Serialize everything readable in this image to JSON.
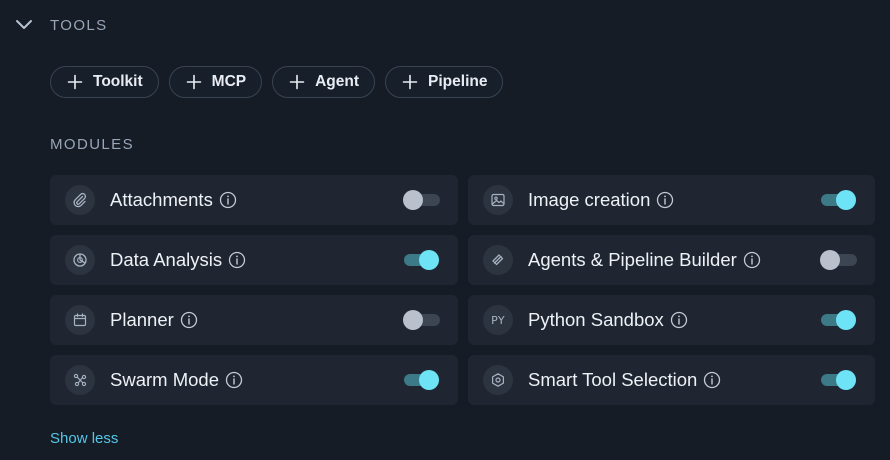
{
  "tools": {
    "title": "TOOLS",
    "add_buttons": [
      {
        "label": "Toolkit"
      },
      {
        "label": "MCP"
      },
      {
        "label": "Agent"
      },
      {
        "label": "Pipeline"
      }
    ]
  },
  "modules": {
    "title": "MODULES",
    "items": [
      {
        "label": "Attachments",
        "icon": "paperclip-icon",
        "enabled": false
      },
      {
        "label": "Image creation",
        "icon": "image-icon",
        "enabled": true
      },
      {
        "label": "Data Analysis",
        "icon": "pie-chart-icon",
        "enabled": true
      },
      {
        "label": "Agents & Pipeline Builder",
        "icon": "layers-icon",
        "enabled": false
      },
      {
        "label": "Planner",
        "icon": "calendar-icon",
        "enabled": false
      },
      {
        "label": "Python Sandbox",
        "icon": "py-icon",
        "icon_text": "PY",
        "enabled": true
      },
      {
        "label": "Swarm Mode",
        "icon": "network-icon",
        "enabled": true
      },
      {
        "label": "Smart Tool Selection",
        "icon": "hexagon-icon",
        "enabled": true
      }
    ]
  },
  "footer": {
    "show_less_label": "Show less"
  },
  "colors": {
    "background": "#151c26",
    "card": "#1f2632",
    "accent": "#6fe3f6",
    "link": "#53c7e6"
  }
}
